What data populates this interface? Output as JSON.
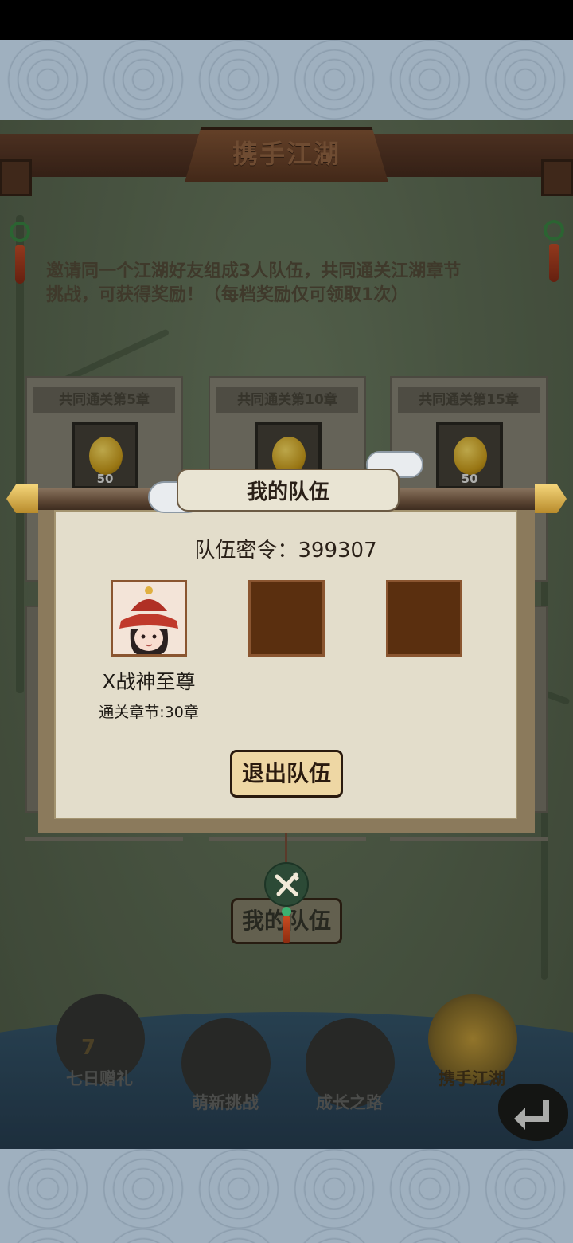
{
  "header": {
    "title": "携手江湖"
  },
  "intro": {
    "line1": "邀请同一个江湖好友组成3人队伍，共同通关江湖章节",
    "line2": "挑战，可获得奖励！（每档奖励仅可领取1次）"
  },
  "rewards": [
    {
      "label": "共同通关第5章",
      "count": "50"
    },
    {
      "label": "共同通关第10章",
      "count": ""
    },
    {
      "label": "共同通关第15章",
      "count": "50"
    }
  ],
  "dialog": {
    "title": "我的队伍",
    "password_label": "队伍密令：",
    "password_value": "399307",
    "member": {
      "name": "X战神至尊",
      "chapter": "通关章节:30章"
    },
    "empty_slots": 2,
    "leave_button": "退出队伍"
  },
  "bg_button": {
    "label": "我的队伍"
  },
  "nav": {
    "items": [
      {
        "label": "七日赠礼",
        "badge": "7"
      },
      {
        "label": "萌新挑战"
      },
      {
        "label": "成长之路"
      },
      {
        "label": "携手江湖"
      }
    ]
  },
  "colors": {
    "accent_gold": "#e8b030",
    "button_fill": "#eed7a4",
    "slot_empty": "#5a2f0f"
  },
  "icons": {
    "close": "close-icon",
    "back": "back-arrow-icon",
    "reward": "gold-gourd-icon"
  }
}
